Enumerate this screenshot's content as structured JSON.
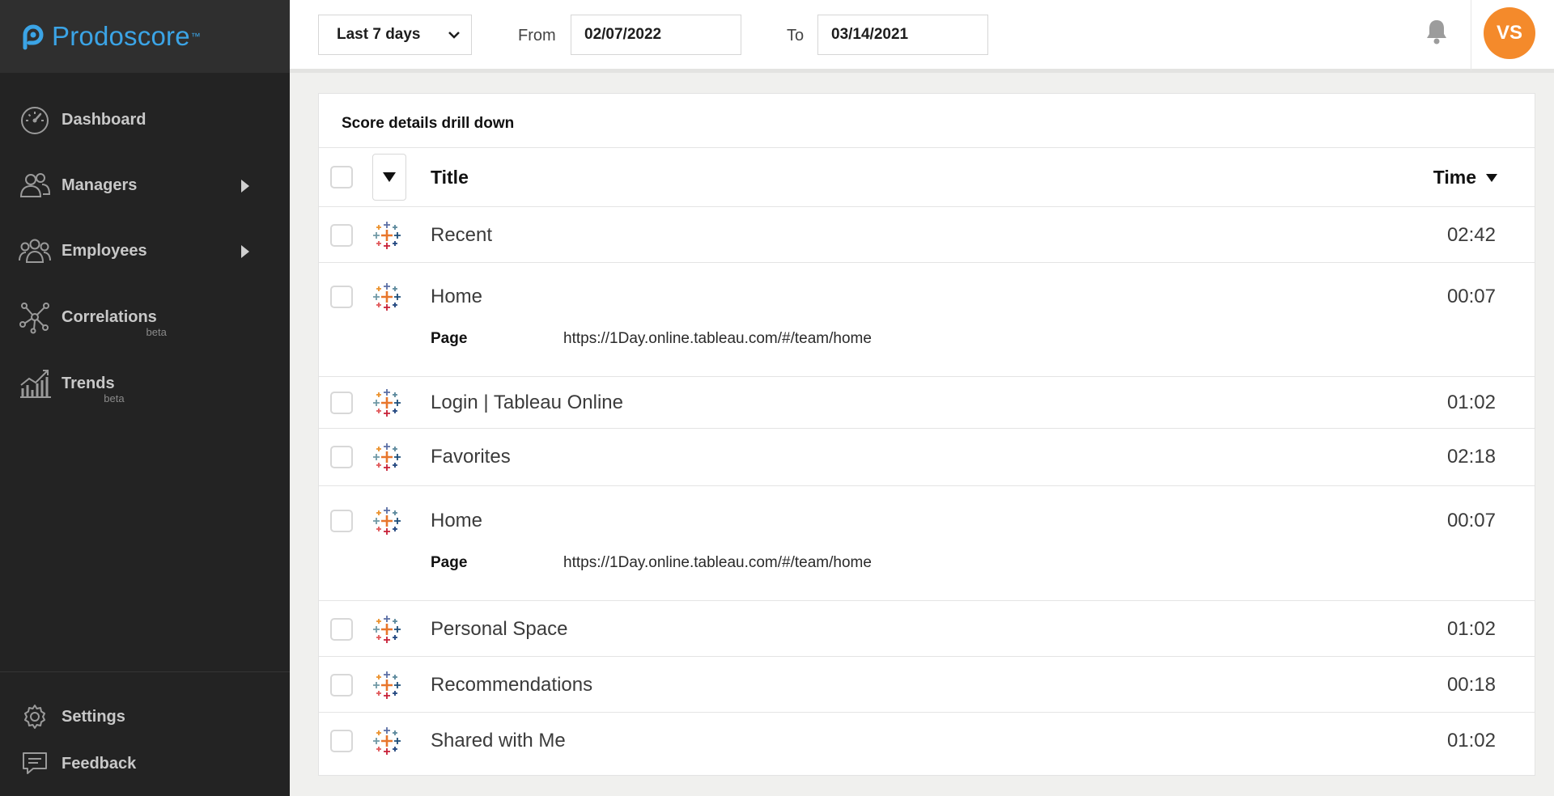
{
  "brand": {
    "name": "Prodoscore",
    "trademark": "™",
    "color": "#3ba4e6"
  },
  "sidebar": {
    "items": [
      {
        "label": "Dashboard",
        "icon": "speedometer-icon"
      },
      {
        "label": "Managers",
        "icon": "managers-icon"
      },
      {
        "label": "Employees",
        "icon": "employees-icon"
      },
      {
        "label": "Correlations",
        "beta": "beta",
        "icon": "network-icon"
      },
      {
        "label": "Trends",
        "beta": "beta",
        "icon": "trends-chart-icon"
      }
    ],
    "bottom": [
      {
        "label": "Settings",
        "icon": "gear-icon"
      },
      {
        "label": "Feedback",
        "icon": "feedback-icon"
      }
    ]
  },
  "topbar": {
    "range": "Last 7 days",
    "from_label": "From",
    "from_value": "02/07/2022",
    "to_label": "To",
    "to_value": "03/14/2021",
    "avatar_initials": "VS",
    "avatar_color": "#f48a2b"
  },
  "card": {
    "title": "Score details drill down",
    "columns": {
      "title": "Title",
      "time": "Time"
    },
    "page_label": "Page",
    "rows": [
      {
        "title": "Recent",
        "time": "02:42"
      },
      {
        "title": "Home",
        "time": "00:07",
        "page": "https://1Day.online.tableau.com/#/team/home"
      },
      {
        "title": "Login | Tableau Online",
        "time": "01:02"
      },
      {
        "title": "Favorites",
        "time": "02:18"
      },
      {
        "title": "Home",
        "time": "00:07",
        "page": "https://1Day.online.tableau.com/#/team/home"
      },
      {
        "title": "Personal Space",
        "time": "01:02"
      },
      {
        "title": "Recommendations",
        "time": "00:18"
      },
      {
        "title": "Shared with Me",
        "time": "01:02"
      }
    ]
  }
}
